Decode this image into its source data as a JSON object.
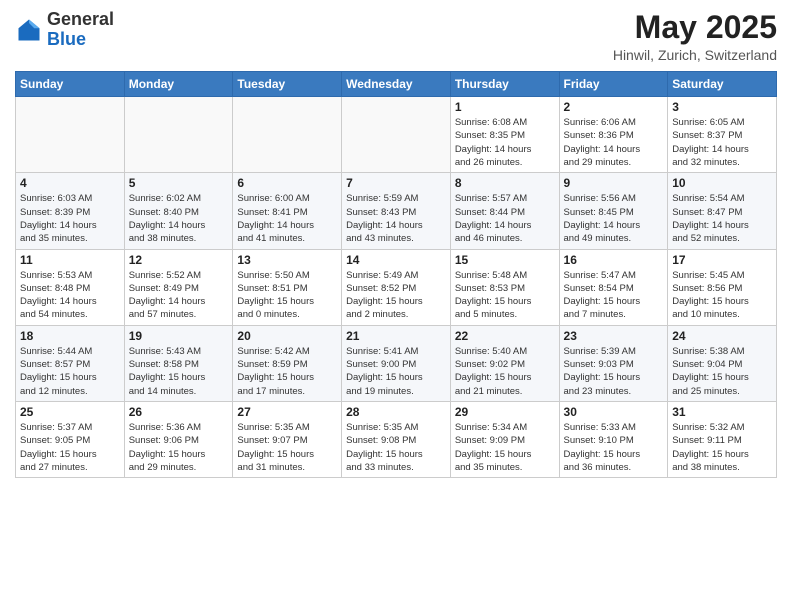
{
  "header": {
    "logo_general": "General",
    "logo_blue": "Blue",
    "month_title": "May 2025",
    "location": "Hinwil, Zurich, Switzerland"
  },
  "days_of_week": [
    "Sunday",
    "Monday",
    "Tuesday",
    "Wednesday",
    "Thursday",
    "Friday",
    "Saturday"
  ],
  "weeks": [
    [
      {
        "day": "",
        "info": ""
      },
      {
        "day": "",
        "info": ""
      },
      {
        "day": "",
        "info": ""
      },
      {
        "day": "",
        "info": ""
      },
      {
        "day": "1",
        "info": "Sunrise: 6:08 AM\nSunset: 8:35 PM\nDaylight: 14 hours\nand 26 minutes."
      },
      {
        "day": "2",
        "info": "Sunrise: 6:06 AM\nSunset: 8:36 PM\nDaylight: 14 hours\nand 29 minutes."
      },
      {
        "day": "3",
        "info": "Sunrise: 6:05 AM\nSunset: 8:37 PM\nDaylight: 14 hours\nand 32 minutes."
      }
    ],
    [
      {
        "day": "4",
        "info": "Sunrise: 6:03 AM\nSunset: 8:39 PM\nDaylight: 14 hours\nand 35 minutes."
      },
      {
        "day": "5",
        "info": "Sunrise: 6:02 AM\nSunset: 8:40 PM\nDaylight: 14 hours\nand 38 minutes."
      },
      {
        "day": "6",
        "info": "Sunrise: 6:00 AM\nSunset: 8:41 PM\nDaylight: 14 hours\nand 41 minutes."
      },
      {
        "day": "7",
        "info": "Sunrise: 5:59 AM\nSunset: 8:43 PM\nDaylight: 14 hours\nand 43 minutes."
      },
      {
        "day": "8",
        "info": "Sunrise: 5:57 AM\nSunset: 8:44 PM\nDaylight: 14 hours\nand 46 minutes."
      },
      {
        "day": "9",
        "info": "Sunrise: 5:56 AM\nSunset: 8:45 PM\nDaylight: 14 hours\nand 49 minutes."
      },
      {
        "day": "10",
        "info": "Sunrise: 5:54 AM\nSunset: 8:47 PM\nDaylight: 14 hours\nand 52 minutes."
      }
    ],
    [
      {
        "day": "11",
        "info": "Sunrise: 5:53 AM\nSunset: 8:48 PM\nDaylight: 14 hours\nand 54 minutes."
      },
      {
        "day": "12",
        "info": "Sunrise: 5:52 AM\nSunset: 8:49 PM\nDaylight: 14 hours\nand 57 minutes."
      },
      {
        "day": "13",
        "info": "Sunrise: 5:50 AM\nSunset: 8:51 PM\nDaylight: 15 hours\nand 0 minutes."
      },
      {
        "day": "14",
        "info": "Sunrise: 5:49 AM\nSunset: 8:52 PM\nDaylight: 15 hours\nand 2 minutes."
      },
      {
        "day": "15",
        "info": "Sunrise: 5:48 AM\nSunset: 8:53 PM\nDaylight: 15 hours\nand 5 minutes."
      },
      {
        "day": "16",
        "info": "Sunrise: 5:47 AM\nSunset: 8:54 PM\nDaylight: 15 hours\nand 7 minutes."
      },
      {
        "day": "17",
        "info": "Sunrise: 5:45 AM\nSunset: 8:56 PM\nDaylight: 15 hours\nand 10 minutes."
      }
    ],
    [
      {
        "day": "18",
        "info": "Sunrise: 5:44 AM\nSunset: 8:57 PM\nDaylight: 15 hours\nand 12 minutes."
      },
      {
        "day": "19",
        "info": "Sunrise: 5:43 AM\nSunset: 8:58 PM\nDaylight: 15 hours\nand 14 minutes."
      },
      {
        "day": "20",
        "info": "Sunrise: 5:42 AM\nSunset: 8:59 PM\nDaylight: 15 hours\nand 17 minutes."
      },
      {
        "day": "21",
        "info": "Sunrise: 5:41 AM\nSunset: 9:00 PM\nDaylight: 15 hours\nand 19 minutes."
      },
      {
        "day": "22",
        "info": "Sunrise: 5:40 AM\nSunset: 9:02 PM\nDaylight: 15 hours\nand 21 minutes."
      },
      {
        "day": "23",
        "info": "Sunrise: 5:39 AM\nSunset: 9:03 PM\nDaylight: 15 hours\nand 23 minutes."
      },
      {
        "day": "24",
        "info": "Sunrise: 5:38 AM\nSunset: 9:04 PM\nDaylight: 15 hours\nand 25 minutes."
      }
    ],
    [
      {
        "day": "25",
        "info": "Sunrise: 5:37 AM\nSunset: 9:05 PM\nDaylight: 15 hours\nand 27 minutes."
      },
      {
        "day": "26",
        "info": "Sunrise: 5:36 AM\nSunset: 9:06 PM\nDaylight: 15 hours\nand 29 minutes."
      },
      {
        "day": "27",
        "info": "Sunrise: 5:35 AM\nSunset: 9:07 PM\nDaylight: 15 hours\nand 31 minutes."
      },
      {
        "day": "28",
        "info": "Sunrise: 5:35 AM\nSunset: 9:08 PM\nDaylight: 15 hours\nand 33 minutes."
      },
      {
        "day": "29",
        "info": "Sunrise: 5:34 AM\nSunset: 9:09 PM\nDaylight: 15 hours\nand 35 minutes."
      },
      {
        "day": "30",
        "info": "Sunrise: 5:33 AM\nSunset: 9:10 PM\nDaylight: 15 hours\nand 36 minutes."
      },
      {
        "day": "31",
        "info": "Sunrise: 5:32 AM\nSunset: 9:11 PM\nDaylight: 15 hours\nand 38 minutes."
      }
    ]
  ]
}
